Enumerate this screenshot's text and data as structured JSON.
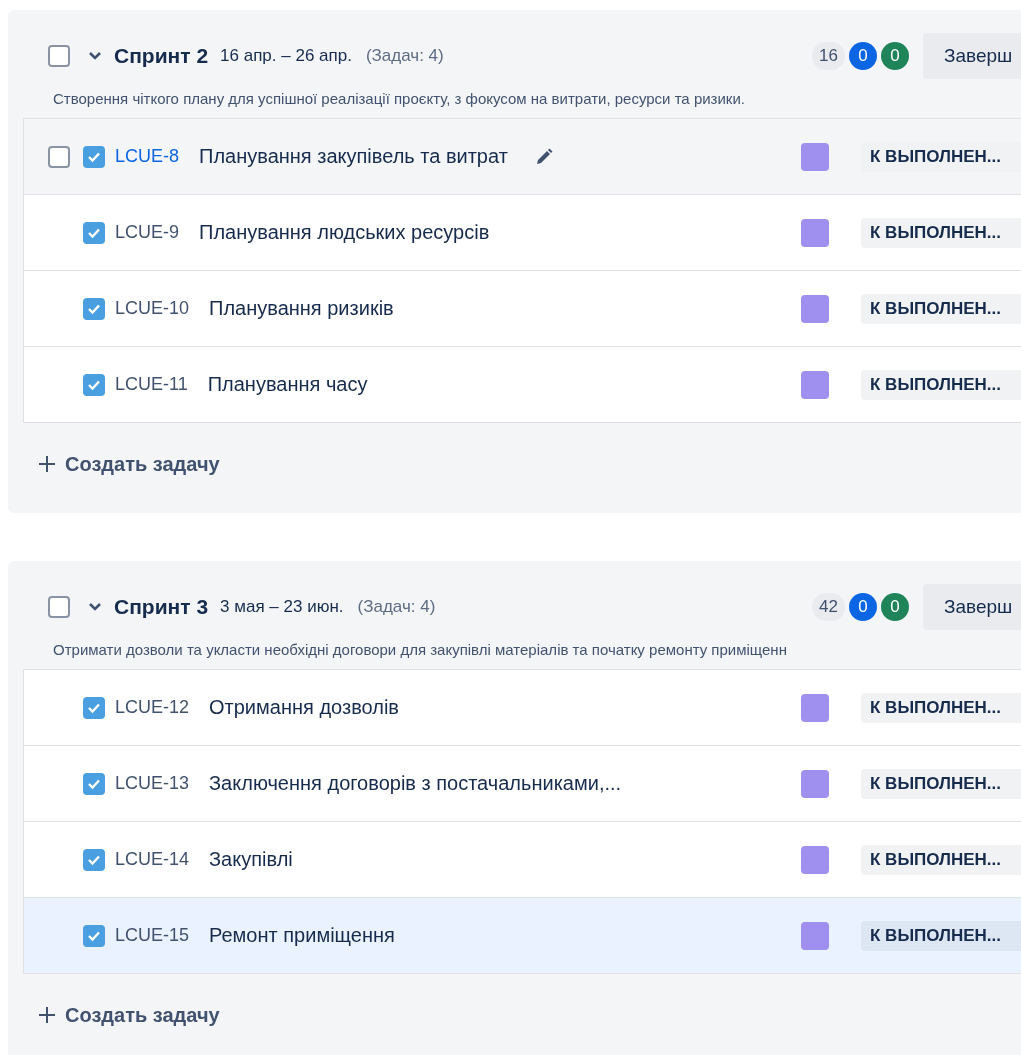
{
  "sprints": [
    {
      "name": "Спринт 2",
      "dates": "16 апр. – 26 апр.",
      "count": "(Задач: 4)",
      "checked": false,
      "expanded": true,
      "points": "16",
      "in_progress": "0",
      "done": "0",
      "action": "Заверш",
      "goal": "Створення чіткого плану для успішної реалізації проєкту, з фокусом на витрати, ресурси та ризики.",
      "create_label": "Создать задачу",
      "issues": [
        {
          "key": "LCUE-8",
          "title": "Планування закупівель та витрат",
          "status": "К ВЫПОЛНЕН...",
          "hovered": true,
          "selected": false,
          "row_checked": false,
          "type_checked": true
        },
        {
          "key": "LCUE-9",
          "title": "Планування людських ресурсів",
          "status": "К ВЫПОЛНЕН...",
          "hovered": false,
          "selected": false,
          "row_checked": false,
          "type_checked": true
        },
        {
          "key": "LCUE-10",
          "title": "Планування ризиків",
          "status": "К ВЫПОЛНЕН...",
          "hovered": false,
          "selected": false,
          "row_checked": false,
          "type_checked": true
        },
        {
          "key": "LCUE-11",
          "title": "Планування часу",
          "status": "К ВЫПОЛНЕН...",
          "hovered": false,
          "selected": false,
          "row_checked": false,
          "type_checked": true
        }
      ]
    },
    {
      "name": "Спринт 3",
      "dates": "3 мая – 23 июн.",
      "count": "(Задач: 4)",
      "checked": false,
      "expanded": true,
      "points": "42",
      "in_progress": "0",
      "done": "0",
      "action": "Заверш",
      "goal": "Отримати дозволи та укласти необхідні договори для закупівлі матеріалів та початку ремонту приміщенн",
      "create_label": "Создать задачу",
      "issues": [
        {
          "key": "LCUE-12",
          "title": "Отримання дозволів",
          "status": "К ВЫПОЛНЕН...",
          "hovered": false,
          "selected": false,
          "row_checked": false,
          "type_checked": true
        },
        {
          "key": "LCUE-13",
          "title": "Заключення договорів з постачальниками,...",
          "status": "К ВЫПОЛНЕН...",
          "hovered": false,
          "selected": false,
          "row_checked": false,
          "type_checked": true
        },
        {
          "key": "LCUE-14",
          "title": "Закупівлі",
          "status": "К ВЫПОЛНЕН...",
          "hovered": false,
          "selected": false,
          "row_checked": false,
          "type_checked": true
        },
        {
          "key": "LCUE-15",
          "title": "Ремонт приміщення",
          "status": "К ВЫПОЛНЕН...",
          "hovered": false,
          "selected": true,
          "row_checked": false,
          "type_checked": true
        }
      ]
    }
  ]
}
